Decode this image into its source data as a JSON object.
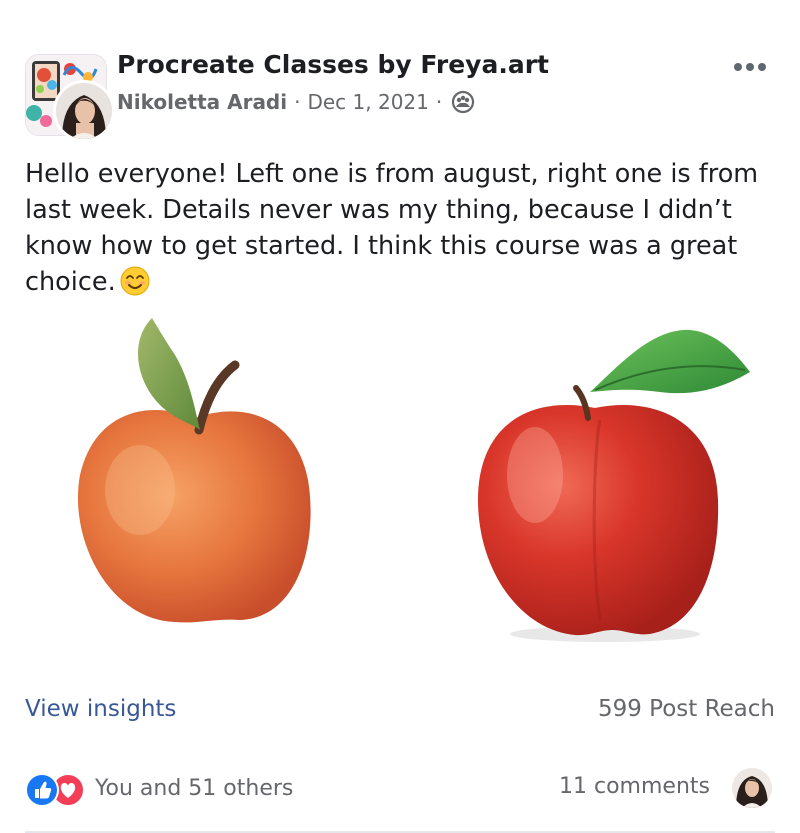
{
  "post": {
    "group_name": "Procreate Classes by Freya.art",
    "author": "Nikoletta Aradi",
    "separator": "·",
    "date": "Dec 1, 2021",
    "privacy_icon": "members-icon",
    "more_icon": "more-options-icon",
    "text": "Hello everyone! Left one is from august, right one is from last week. Details never was my thing, because I didn’t know how to get started. I think this course was a great choice.",
    "text_emoji": "smiling-face-icon"
  },
  "images": {
    "left": "apple-drawing-august",
    "right": "apple-drawing-last-week"
  },
  "insights": {
    "view_label": "View insights",
    "reach_label": "599 Post Reach"
  },
  "engagement": {
    "reaction_icons": [
      "like-icon",
      "love-icon"
    ],
    "reactions_text": "You and 51 others",
    "comments_label": "11 comments"
  },
  "colors": {
    "link": "#385898",
    "like": "#1877f2",
    "love": "#f33e58"
  }
}
